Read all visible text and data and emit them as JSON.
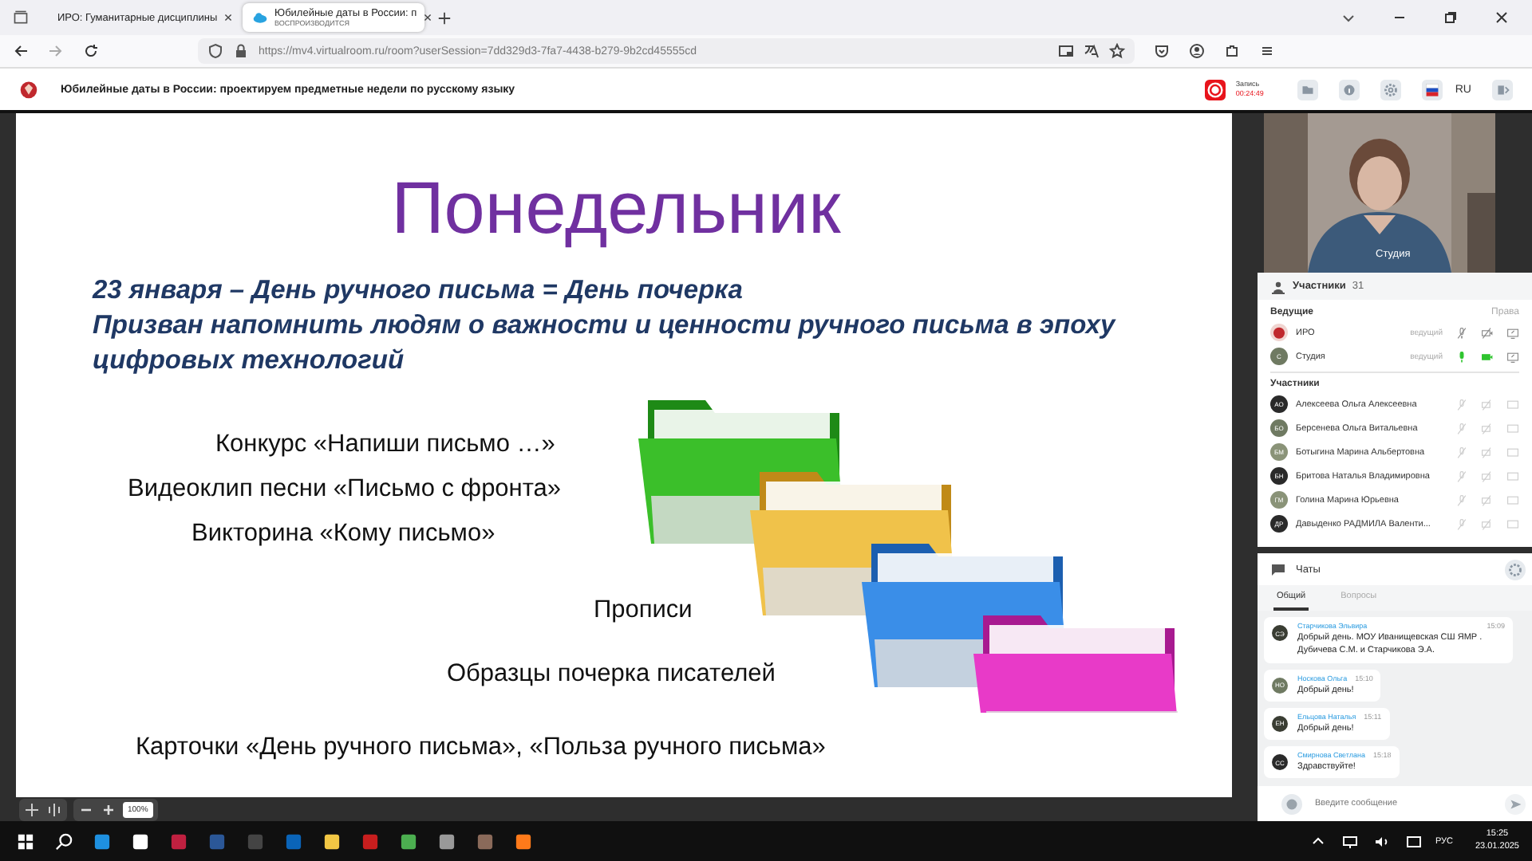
{
  "browser": {
    "tabs": [
      {
        "title": "ИРО: Гуманитарные дисциплины",
        "selected": false
      },
      {
        "title": "Юбилейные даты в России: п",
        "subtitle": "ВОСПРОИЗВОДИТСЯ",
        "selected": true
      }
    ],
    "url": "https://mv4.virtualroom.ru/room?userSession=7dd329d3-7fa7-4438-b279-9b2cd45555cd"
  },
  "app": {
    "title": "Юбилейные даты в России: проектируем предметные недели по русскому языку",
    "recording": {
      "label": "Запись",
      "time": "00:24:49"
    },
    "language": "RU"
  },
  "slide": {
    "title": "Понедельник",
    "heading": [
      "23 января – День ручного письма = День почерка",
      "Призван напомнить людям о важности и ценности ручного письма в эпоху",
      "цифровых технологий"
    ],
    "items": [
      "Конкурс «Напиши письмо …»",
      "Видеоклип песни «Письмо с фронта»",
      "Викторина «Кому письмо»",
      "Прописи",
      "Образцы почерка писателей",
      "Карточки «День ручного письма», «Польза ручного письма»"
    ]
  },
  "zoom": "100%",
  "video": {
    "label": "Студия"
  },
  "participants": {
    "title": "Участники",
    "count": "31",
    "hosts_title": "Ведущие",
    "rights": "Права",
    "hosts": [
      {
        "name": "ИРО",
        "kind": "logo",
        "role": "ведущий",
        "mic_on": false,
        "cam_on": false
      },
      {
        "name": "Студия",
        "kind": "initials",
        "initials": "С",
        "color": "#6f7a62",
        "role": "ведущий",
        "mic_on": true,
        "cam_on": true
      }
    ],
    "members_title": "Участники",
    "members": [
      {
        "initials": "АО",
        "name": "Алексеева Ольга Алексеевна",
        "color": "#2a2a2a"
      },
      {
        "initials": "БО",
        "name": "Берсенева Ольга Витальевна",
        "color": "#6f7a62"
      },
      {
        "initials": "БМ",
        "name": "Ботыгина Марина Альбертовна",
        "color": "#8a9378"
      },
      {
        "initials": "БН",
        "name": "Бритова Наталья Владимировна",
        "color": "#2a2a2a"
      },
      {
        "initials": "ГМ",
        "name": "Голина Марина Юрьевна",
        "color": "#8a9378"
      },
      {
        "initials": "ДР",
        "name": "Давыденко РАДМИЛА Валенти...",
        "color": "#2a2a2a"
      }
    ]
  },
  "chat": {
    "title": "Чаты",
    "tabs": [
      {
        "label": "Общий",
        "selected": true
      },
      {
        "label": "Вопросы",
        "selected": false
      }
    ],
    "messages": [
      {
        "initials": "СЭ",
        "color": "#3a3d33",
        "author": "Старчикова Эльвира",
        "time": "15:09",
        "text": "Добрый день. МОУ Иванищевская СШ ЯМР . Дубичева С.М. и Старчикова Э.А."
      },
      {
        "initials": "НО",
        "color": "#6f7a62",
        "author": "Носкова Ольга",
        "time": "15:10",
        "text": "Добрый день!"
      },
      {
        "initials": "ЕН",
        "color": "#3a3d33",
        "author": "Ельцова Наталья",
        "time": "15:11",
        "text": "Добрый день!"
      },
      {
        "initials": "СС",
        "color": "#2a2a2a",
        "author": "Смирнова Светлана",
        "time": "15:18",
        "text": "Здравствуйте!"
      }
    ],
    "placeholder": "Введите сообщение"
  },
  "taskbar": {
    "language": "РУС",
    "time": "15:25",
    "date": "23.01.2025"
  }
}
